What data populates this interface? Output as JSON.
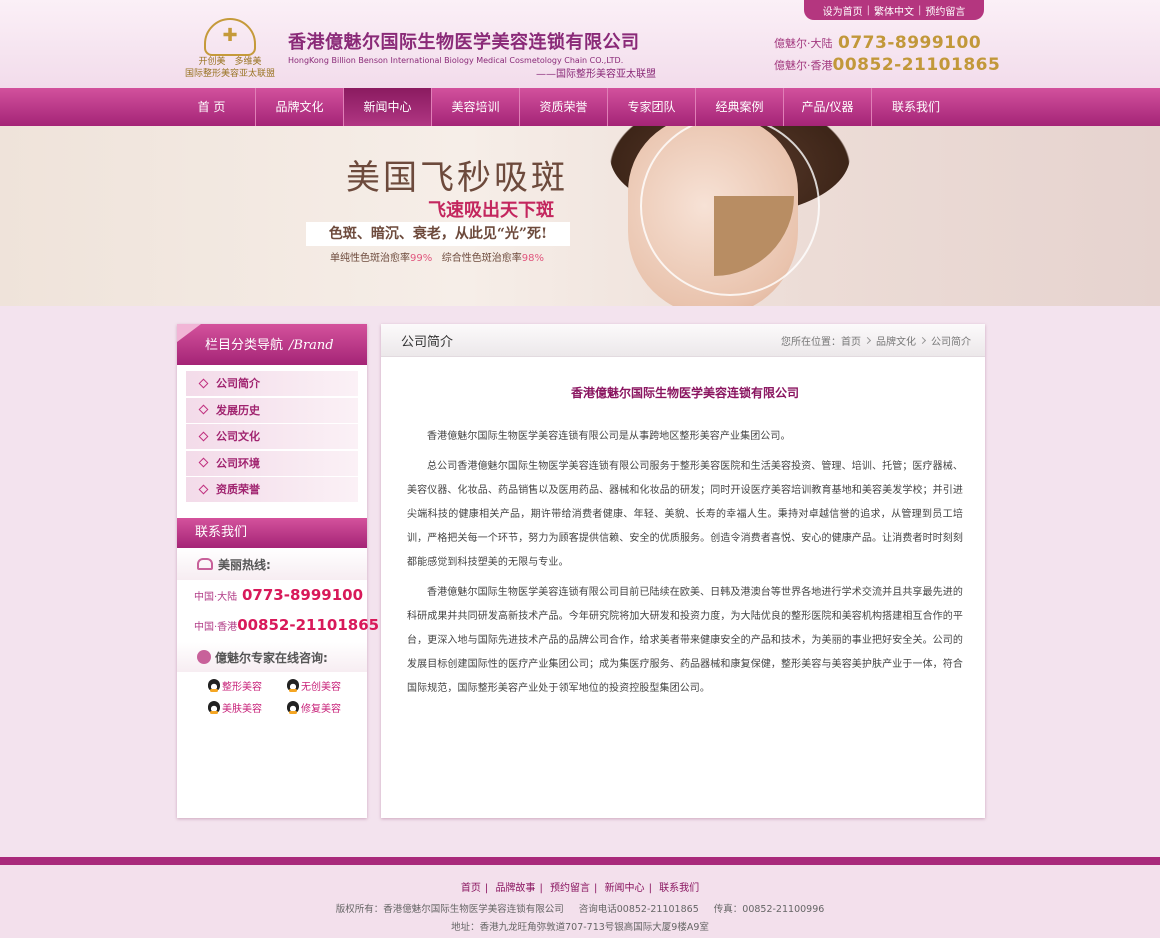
{
  "header": {
    "logo_slogan_1": "开创美　多维美",
    "logo_slogan_2": "国际整形美容亚太联盟",
    "logo_mark": "DR-TIME",
    "company_cn": "香港億魅尔国际生物医学美容连锁有限公司",
    "company_en": "HongKong Billion Benson International Biology Medical Cosmetology Chain CO.,LTD.",
    "company_sub": "——国际整形美容亚太联盟",
    "top_links": [
      "设为首页",
      "繁体中文",
      "预约留言"
    ],
    "phones": [
      {
        "label": "億魅尔·大陆",
        "number": "0773-8999100"
      },
      {
        "label": "億魅尔·香港",
        "number": "00852-21101865"
      }
    ]
  },
  "nav": {
    "items": [
      "首 页",
      "品牌文化",
      "新闻中心",
      "美容培训",
      "资质荣誉",
      "专家团队",
      "经典案例",
      "产品/仪器",
      "联系我们"
    ],
    "active_index": 2
  },
  "banner": {
    "headline": "美国飞秒吸斑",
    "subheadline": "飞速吸出天下斑",
    "tagline": "色斑、暗沉、衰老，从此见“光”死!",
    "stat1_label": "单纯性色斑治愈率",
    "stat1_value": "99%",
    "stat2_label": "综合性色斑治愈率",
    "stat2_value": "98%"
  },
  "sidebar": {
    "title": "栏目分类导航",
    "title_brand": "/Brand",
    "menu": [
      "公司简介",
      "发展历史",
      "公司文化",
      "公司环境",
      "资质荣誉"
    ],
    "contact_title": "联系我们",
    "hotline_label": "美丽热线:",
    "phones": [
      {
        "label": "中国·大陆",
        "number": "0773-8999100"
      },
      {
        "label": "中国·香港",
        "number": "00852-21101865"
      }
    ],
    "online_label": "億魅尔专家在线咨询:",
    "qq": [
      "整形美容",
      "无创美容",
      "美肤美容",
      "修复美容"
    ]
  },
  "main": {
    "section_title": "公司简介",
    "breadcrumb_prefix": "您所在位置：",
    "breadcrumb": [
      "首页",
      "品牌文化",
      "公司简介"
    ],
    "article_title": "香港億魅尔国际生物医学美容连锁有限公司",
    "paragraphs": [
      "香港億魅尔国际生物医学美容连锁有限公司是从事跨地区整形美容产业集团公司。",
      "总公司香港億魅尔国际生物医学美容连锁有限公司服务于整形美容医院和生活美容投资、管理、培训、托管；医疗器械、美容仪器、化妆品、药品销售以及医用药品、器械和化妆品的研发；同时开设医疗美容培训教育基地和美容美发学校；并引进尖端科技的健康相关产品，期许带给消费者健康、年轻、美貌、长寿的幸福人生。秉持对卓越信誉的追求，从管理到员工培训，严格把关每一个环节，努力为顾客提供信赖、安全的优质服务。创造令消费者喜悦、安心的健康产品。让消费者时时刻刻都能感觉到科技塑美的无限与专业。",
      "香港億魅尔国际生物医学美容连锁有限公司目前已陆续在欧美、日韩及港澳台等世界各地进行学术交流并且共享最先进的科研成果并共同研发高新技术产品。今年研究院将加大研发和投资力度，为大陆优良的整形医院和美容机构搭建相互合作的平台，更深入地与国际先进技术产品的品牌公司合作，给求美者带来健康安全的产品和技术，为美丽的事业把好安全关。公司的发展目标创建国际性的医疗产业集团公司；成为集医疗服务、药品器械和康复保健，整形美容与美容美护肤产业于一体，符合国际规范，国际整形美容产业处于领军地位的投资控股型集团公司。"
    ]
  },
  "footer": {
    "links": [
      "首页",
      "品牌故事",
      "预约留言",
      "新闻中心",
      "联系我们"
    ],
    "copyright": "版权所有：香港億魅尔国际生物医学美容连锁有限公司",
    "tel": "咨询电话00852-21101865",
    "fax": "传真：00852-21100996",
    "address": "地址：香港九龙旺角弥敦道707-713号银高国际大厦9楼A9室"
  },
  "colors": {
    "brand_magenta": "#a42476",
    "gold": "#c2983a",
    "hot_pink": "#d8195a"
  }
}
